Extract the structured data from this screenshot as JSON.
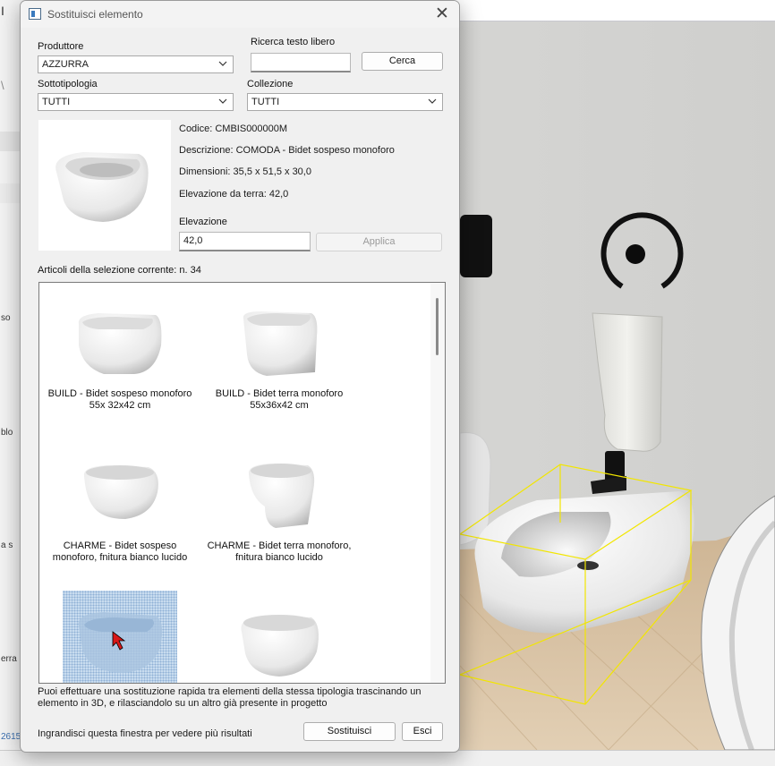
{
  "background": {
    "left_fragments": [
      "I",
      "\\",
      "so",
      "blo",
      "a s",
      "erra",
      "2615"
    ]
  },
  "dialog": {
    "title": "Sostituisci elemento",
    "produttore": {
      "label": "Produttore",
      "value": "AZZURRA"
    },
    "ricerca": {
      "label": "Ricerca testo libero",
      "value": "",
      "button": "Cerca"
    },
    "sottotipologia": {
      "label": "Sottotipologia",
      "value": "TUTTI"
    },
    "collezione": {
      "label": "Collezione",
      "value": "TUTTI"
    },
    "details": {
      "codice": "Codice: CMBIS000000M",
      "descrizione": "Descrizione: COMODA - Bidet sospeso monoforo",
      "dimensioni": "Dimensioni: 35,5 x 51,5 x 30,0",
      "elevazione_terra": "Elevazione da terra: 42,0"
    },
    "elevazione": {
      "label": "Elevazione",
      "value": "42,0",
      "button": "Applica"
    },
    "count_label": "Articoli della selezione corrente: n. 34",
    "items": [
      {
        "line1": "BUILD - Bidet sospeso monoforo",
        "line2": "55x 32x42 cm"
      },
      {
        "line1": "BUILD - Bidet terra monoforo",
        "line2": "55x36x42 cm"
      },
      {
        "line1": "CHARME - Bidet sospeso",
        "line2": "monoforo, fnitura bianco lucido"
      },
      {
        "line1": "CHARME - Bidet terra monoforo,",
        "line2": "fnitura bianco lucido"
      },
      {
        "line1": "",
        "line2": ""
      },
      {
        "line1": "",
        "line2": ""
      }
    ],
    "hint": "Puoi effettuare una sostituzione rapida tra elementi della stessa tipologia trascinando un elemento in 3D, e rilasciandolo su un altro già presente in progetto",
    "enlarge_hint": "Ingrandisci questa finestra per vedere più risultati",
    "btn_sostituisci": "Sostituisci",
    "btn_esci": "Esci"
  },
  "colors": {
    "selection": "#c8dcef",
    "bbox": "#f2e600",
    "floor": "#d9c3a4"
  }
}
